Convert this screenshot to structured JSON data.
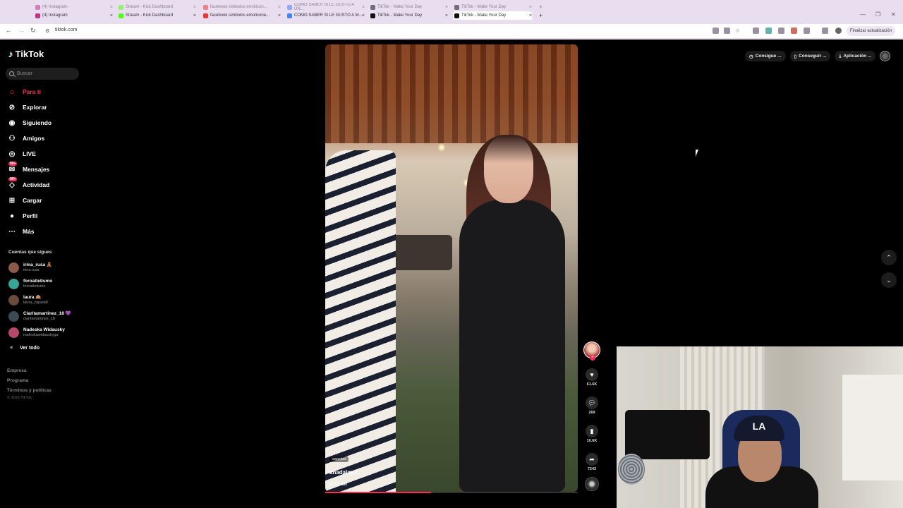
{
  "browser": {
    "tabs_row1": [
      {
        "label": "(4) Instagram",
        "color": "#c13584"
      },
      {
        "label": "Stream - Kick Dashboard",
        "color": "#53fc18"
      },
      {
        "label": "facebook simbolos emoticon...",
        "color": "#e53935"
      },
      {
        "label": "COMO SABER SI LE GUSTO A UN...",
        "color": "#4285f4"
      },
      {
        "label": "TikTok - Make Your Day",
        "color": "#111111"
      },
      {
        "label": "TikTok - Make Your Day",
        "color": "#111111"
      }
    ],
    "tabs_row2": [
      {
        "label": "(4) Instagram",
        "color": "#c13584"
      },
      {
        "label": "Stream - Kick Dashboard",
        "color": "#53fc18"
      },
      {
        "label": "facebook simbolos emoticone...",
        "color": "#e53935"
      },
      {
        "label": "COMO SABER SI LE GUSTO A M...",
        "color": "#4285f4"
      },
      {
        "label": "TikTok - Make Your Day",
        "color": "#111111"
      },
      {
        "label": "TikTok - Make Your Day",
        "color": "#111111"
      }
    ],
    "url": "tiktok.com",
    "update_button": "Finalizar actualización"
  },
  "sidebar": {
    "logo": "TikTok",
    "search_placeholder": "Buscar",
    "nav": [
      {
        "label": "Para ti",
        "icon": "home-icon",
        "active": true
      },
      {
        "label": "Explorar",
        "icon": "compass-icon"
      },
      {
        "label": "Siguiendo",
        "icon": "following-icon"
      },
      {
        "label": "Amigos",
        "icon": "friends-icon"
      },
      {
        "label": "LIVE",
        "icon": "live-icon"
      },
      {
        "label": "Mensajes",
        "icon": "messages-icon",
        "badge": "99+"
      },
      {
        "label": "Actividad",
        "icon": "activity-icon",
        "badge": "99+"
      },
      {
        "label": "Cargar",
        "icon": "upload-icon"
      },
      {
        "label": "Perfil",
        "icon": "profile-icon"
      },
      {
        "label": "Más",
        "icon": "more-icon"
      }
    ],
    "following_title": "Cuentas que sigues",
    "following": [
      {
        "name": "irina_rusa 🧸",
        "handle": "irina.rusa",
        "color": "#8a5a4a"
      },
      {
        "name": "foroatletismo",
        "handle": "foroatletismo",
        "color": "#3aa39a"
      },
      {
        "name": "laura 🙈",
        "handle": "laura_zapata8",
        "color": "#6a4a3a"
      },
      {
        "name": "Claritamartinez_18 💜",
        "handle": "claritamartinez_18",
        "color": "#3b4a55"
      },
      {
        "name": "Nadeska Widausky",
        "handle": "nadeskawidauskyga",
        "color": "#b44a6a"
      }
    ],
    "see_all": "Ver todo",
    "footer": [
      "Empresa",
      "Programa",
      "Términos y políticas"
    ],
    "copyright": "© 2026 TikTok"
  },
  "topbar": {
    "buttons": [
      "Consigue ...",
      "Conseguir ...",
      "Aplicación ..."
    ]
  },
  "video": {
    "tag": "sanchoi",
    "author": "anadalay.x",
    "music": "@Ari Niki",
    "progress": 0.42,
    "likes": "61.6K",
    "comments": "269",
    "saves": "10.6K",
    "shares": "7243"
  },
  "webcam": {
    "cap_text": "LA"
  }
}
